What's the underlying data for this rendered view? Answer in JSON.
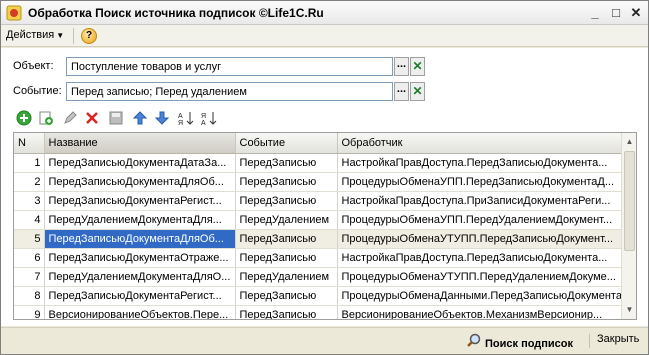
{
  "window": {
    "title": "Обработка  Поиск источника подписок    ©Life1C.Ru",
    "minimize": "_",
    "maximize": "□",
    "close": "✕"
  },
  "commandbar": {
    "actions_label": "Действия",
    "help_label": "?"
  },
  "form": {
    "object_label": "Объект:",
    "object_value": "Поступление товаров и услуг",
    "event_label": "Событие:",
    "event_value": "Перед записью; Перед удалением",
    "ellipsis": "...",
    "clear": "✕"
  },
  "toolbar": {
    "icons": [
      "add-icon",
      "copy-icon",
      "edit-icon",
      "delete-icon",
      "save-icon",
      "move-up-icon",
      "move-down-icon",
      "sort-asc-icon",
      "sort-desc-icon"
    ]
  },
  "table": {
    "columns": [
      "N",
      "Название",
      "Событие",
      "Обработчик"
    ],
    "rows": [
      {
        "n": "1",
        "name": "ПередЗаписьюДокументаДатаЗа...",
        "event": "ПередЗаписью",
        "handler": "НастройкаПравДоступа.ПередЗаписьюДокумента..."
      },
      {
        "n": "2",
        "name": "ПередЗаписьюДокументаДляОб...",
        "event": "ПередЗаписью",
        "handler": "ПроцедурыОбменаУПП.ПередЗаписьюДокументаД..."
      },
      {
        "n": "3",
        "name": "ПередЗаписьюДокументаРегист...",
        "event": "ПередЗаписью",
        "handler": "НастройкаПравДоступа.ПриЗаписиДокументаРеги..."
      },
      {
        "n": "4",
        "name": "ПередУдалениемДокументаДля...",
        "event": "ПередУдалением",
        "handler": "ПроцедурыОбменаУПП.ПередУдалениемДокумент..."
      },
      {
        "n": "5",
        "name": "ПередЗаписьюДокументаДляОб...",
        "event": "ПередЗаписью",
        "handler": "ПроцедурыОбменаУТУПП.ПередЗаписьюДокумент..."
      },
      {
        "n": "6",
        "name": "ПередЗаписьюДокументаОтраже...",
        "event": "ПередЗаписью",
        "handler": "НастройкаПравДоступа.ПередЗаписьюДокумента..."
      },
      {
        "n": "7",
        "name": "ПередУдалениемДокументаДляО...",
        "event": "ПередУдалением",
        "handler": "ПроцедурыОбменаУТУПП.ПередУдалениемДокуме..."
      },
      {
        "n": "8",
        "name": "ПередЗаписьюДокументаРегист...",
        "event": "ПередЗаписью",
        "handler": "ПроцедурыОбменаДанными.ПередЗаписьюДокумента..."
      },
      {
        "n": "9",
        "name": "ВерсионированиеОбъектов.Пере...",
        "event": "ПередЗаписью",
        "handler": "ВерсионированиеОбъектов.МеханизмВерсионир..."
      }
    ],
    "selected_row": 5
  },
  "bottombar": {
    "search_label": "Поиск подписок",
    "close_label": "Закрыть"
  }
}
